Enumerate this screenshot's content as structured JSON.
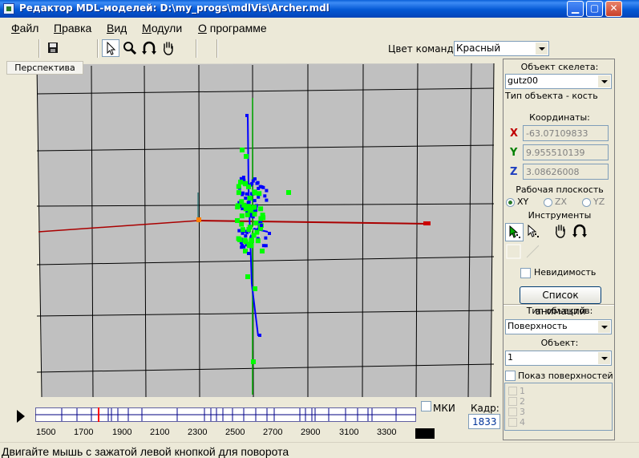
{
  "window": {
    "title": "Редактор MDL-моделей: D:\\my_progs\\mdlVis\\Archer.mdl",
    "minimize": "▁",
    "maximize": "▢",
    "close": "✕"
  },
  "menu": {
    "items": [
      {
        "first": "Ф",
        "rest": "айл"
      },
      {
        "first": "П",
        "rest": "равка"
      },
      {
        "first": "В",
        "rest": "ид"
      },
      {
        "first": "М",
        "rest": "одули"
      },
      {
        "first": "О",
        "rest": " программе"
      }
    ]
  },
  "toolbar": {
    "team_color_label": "Цвет команды:",
    "team_color_value": "Красный",
    "icons": [
      "save-icon",
      "pointer-icon",
      "zoom-icon",
      "rotate-icon",
      "hand-icon"
    ]
  },
  "viewport": {
    "tab_label": "Перспектива"
  },
  "right_panel": {
    "skeleton_label": "Объект скелета:",
    "skeleton_value": "gutz00",
    "object_type": "Тип объекта - кость",
    "coords_label": "Координаты:",
    "x_letter": "X",
    "y_letter": "Y",
    "z_letter": "Z",
    "x_value": "-63.07109833",
    "y_value": "9.955510139",
    "z_value": "3.08626008",
    "work_plane_label": "Рабочая плоскость",
    "plane_options": [
      "XY",
      "ZX",
      "YZ"
    ],
    "plane_selected": "XY",
    "tools_label": "Инструменты",
    "invisibility_label": "Невидимость",
    "anim_list_button": "Список анимаций",
    "object_types_label": "Тип объектов:",
    "object_types_value": "Поверхность",
    "object_label": "Объект:",
    "object_value": "1",
    "show_surfaces_label": "Показ поверхностей",
    "surfaces": [
      "1",
      "2",
      "3",
      "4"
    ]
  },
  "timeline": {
    "tick_labels": [
      "1500",
      "1700",
      "1900",
      "2100",
      "2300",
      "2500",
      "2700",
      "2900",
      "3100",
      "3300"
    ],
    "mki_label": "МКИ",
    "frame_label": "Кадр:",
    "frame_value": "1833"
  },
  "status": {
    "text": "Двигайте мышь с зажатой левой кнопкой для поворота"
  },
  "colors": {
    "titlebar": "#0458d4",
    "viewport_bg": "#c0c0c0",
    "grid": "#000000",
    "bone": "#0000ff",
    "vertex": "#00ff00",
    "axis_x": "#aa0000",
    "axis_y": "#00aa00",
    "timeline_marker": "#ff0000"
  }
}
